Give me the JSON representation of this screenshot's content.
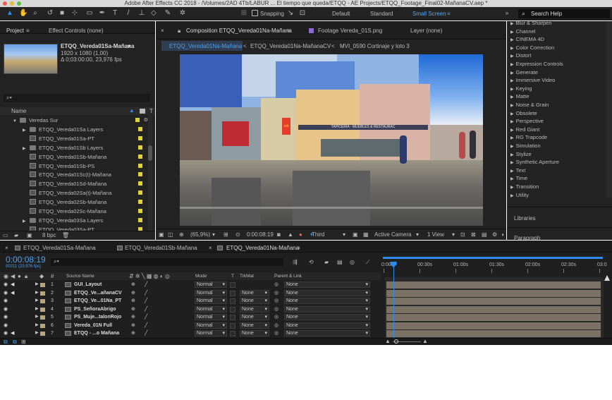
{
  "window": {
    "title": "Adobe After Effects CC 2018 - /Volumes/2AD 4Tb/LABUR ... El tiempo que queda/ETQQ - AE Projects/ETQQ_Footage_Final02-MañanaCV.aep *"
  },
  "toolbar": {
    "snapping": "Snapping",
    "workspaces": [
      "Default",
      "Standard",
      "Small Screen"
    ],
    "search_placeholder": "Search Help"
  },
  "project": {
    "tab": "Project",
    "effect_controls_tab": "Effect Controls (none)",
    "item_name": "ETQQ_Vereda01Sa-Mañana",
    "item_info1": "1920 x 1080 (1,00)",
    "item_info2": "Δ 0;03:00:00, 23,976 fps",
    "col_name": "Name",
    "bpc": "8 bpc",
    "items": [
      {
        "name": "Veredas Sur",
        "type": "folder",
        "indent": 0,
        "open": true
      },
      {
        "name": "ETQQ_Vereda01Sa Layers",
        "type": "folder",
        "indent": 1
      },
      {
        "name": "ETQQ_Vereda01Sa-PT",
        "type": "comp",
        "indent": 1
      },
      {
        "name": "ETQQ_Vereda01Sb Layers",
        "type": "folder",
        "indent": 1
      },
      {
        "name": "ETQQ_Vereda01Sb-Mañana",
        "type": "comp",
        "indent": 1
      },
      {
        "name": "ETQQ_Vereda01Sb-PS",
        "type": "comp",
        "indent": 1
      },
      {
        "name": "ETQQ_Vereda01Sc(t)-Mañana",
        "type": "comp",
        "indent": 1
      },
      {
        "name": "ETQQ_Vereda01Sd-Mañana",
        "type": "comp",
        "indent": 1
      },
      {
        "name": "ETQQ_Vereda02Sa(t)-Mañana",
        "type": "comp",
        "indent": 1
      },
      {
        "name": "ETQQ_Vereda02Sb-Mañana",
        "type": "comp",
        "indent": 1
      },
      {
        "name": "ETQQ_Vereda02Sc-Mañana",
        "type": "comp",
        "indent": 1
      },
      {
        "name": "ETQQ_Vereda03Sa Layers",
        "type": "folder",
        "indent": 1
      },
      {
        "name": "ETQQ_Vereda03Sa-PT",
        "type": "comp",
        "indent": 1
      }
    ]
  },
  "viewer": {
    "composition_tab": "Composition ETQQ_Vereda01Na-Mañana",
    "footage_tab": "Footage Vereda_01S.png",
    "layer_tab": "Layer (none)",
    "breadcrumbs": [
      "ETQQ_Vereda01Na-Mañana",
      "ETQQ_Vereda01Na-MañanaCV",
      "MVI_0590 Cortinaje y loto 3"
    ],
    "zoom": "(65,9%)",
    "timecode": "0:00:08:19",
    "resolution": "Third",
    "camera": "Active Camera",
    "views": "1 View",
    "store_signs": [
      "TAPICERIA - MUEBLES & RESTAURAC",
      "Gift"
    ]
  },
  "effects": {
    "items": [
      "Blur & Sharpen",
      "Channel",
      "CINEMA 4D",
      "Color Correction",
      "Distort",
      "Expression Controls",
      "Generate",
      "Immersive Video",
      "Keying",
      "Matte",
      "Noise & Grain",
      "Obsolete",
      "Perspective",
      "Red Giant",
      "RG Trapcode",
      "Simulation",
      "Stylize",
      "Synthetic Aperture",
      "Text",
      "Time",
      "Transition",
      "Utility"
    ],
    "libraries": "Libraries",
    "paragraph": "Paragraph"
  },
  "timeline": {
    "tabs": [
      "ETQQ_Vereda01Sa-Mañana",
      "ETQQ_Vereda01Sb-Mañana",
      "ETQQ_Vereda01Na-Mañana"
    ],
    "timecode": "0:00:08:19",
    "frames": "00211 (23.976 fps)",
    "col_source": "Source Name",
    "col_mode": "Mode",
    "col_t": "T",
    "col_trkmat": "TrkMat",
    "col_parent": "Parent & Link",
    "ruler": [
      "0:00s",
      "00:30s",
      "01:00s",
      "01:30s",
      "02:00s",
      "02:30s",
      "03:0"
    ],
    "playhead_fraction": 0.047,
    "layers": [
      {
        "num": "1",
        "name": "GUI_Layout",
        "mode": "Normal",
        "trkmat": "",
        "parent": "None",
        "audio": true
      },
      {
        "num": "2",
        "name": "ETQQ_Ve...añanaCV",
        "mode": "Normal",
        "trkmat": "None",
        "parent": "None",
        "audio": true
      },
      {
        "num": "3",
        "name": "ETQQ_Ve...01Na_PT",
        "mode": "Normal",
        "trkmat": "None",
        "parent": "None",
        "audio": false
      },
      {
        "num": "4",
        "name": "PS_SeñoraAbrigo",
        "mode": "Normal",
        "trkmat": "None",
        "parent": "None",
        "audio": false
      },
      {
        "num": "5",
        "name": "PS_Muje...talonRojo",
        "mode": "Normal",
        "trkmat": "None",
        "parent": "None",
        "audio": false
      },
      {
        "num": "6",
        "name": "Vereda_01N Full",
        "mode": "Normal",
        "trkmat": "None",
        "parent": "None",
        "audio": false
      },
      {
        "num": "7",
        "name": "ETQQ - ...o Mañana",
        "mode": "Normal",
        "trkmat": "None",
        "parent": "None",
        "audio": true
      }
    ]
  }
}
